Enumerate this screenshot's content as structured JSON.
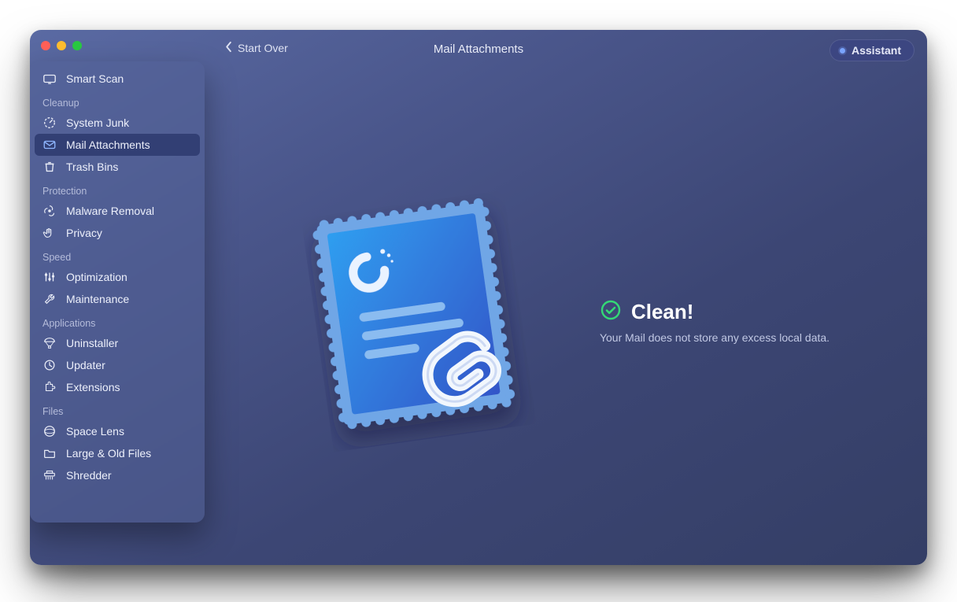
{
  "header": {
    "back_label": "Start Over",
    "title": "Mail Attachments",
    "assistant_label": "Assistant"
  },
  "sidebar": {
    "top_item": {
      "label": "Smart Scan",
      "icon": "scan-icon"
    },
    "sections": [
      {
        "title": "Cleanup",
        "items": [
          {
            "label": "System Junk",
            "icon": "gauge-icon",
            "selected": false
          },
          {
            "label": "Mail Attachments",
            "icon": "mail-icon",
            "selected": true
          },
          {
            "label": "Trash Bins",
            "icon": "trash-icon",
            "selected": false
          }
        ]
      },
      {
        "title": "Protection",
        "items": [
          {
            "label": "Malware Removal",
            "icon": "hazard-icon",
            "selected": false
          },
          {
            "label": "Privacy",
            "icon": "hand-icon",
            "selected": false
          }
        ]
      },
      {
        "title": "Speed",
        "items": [
          {
            "label": "Optimization",
            "icon": "sliders-icon",
            "selected": false
          },
          {
            "label": "Maintenance",
            "icon": "wrench-icon",
            "selected": false
          }
        ]
      },
      {
        "title": "Applications",
        "items": [
          {
            "label": "Uninstaller",
            "icon": "parachute-icon",
            "selected": false
          },
          {
            "label": "Updater",
            "icon": "updater-icon",
            "selected": false
          },
          {
            "label": "Extensions",
            "icon": "puzzle-icon",
            "selected": false
          }
        ]
      },
      {
        "title": "Files",
        "items": [
          {
            "label": "Space Lens",
            "icon": "lens-icon",
            "selected": false
          },
          {
            "label": "Large & Old Files",
            "icon": "folder-icon",
            "selected": false
          },
          {
            "label": "Shredder",
            "icon": "shredder-icon",
            "selected": false
          }
        ]
      }
    ]
  },
  "result": {
    "title": "Clean!",
    "subtitle": "Your Mail does not store any excess local data."
  },
  "colors": {
    "accent_green": "#34d976",
    "stamp_gradient_start": "#2f9ef0",
    "stamp_gradient_end": "#3255c8"
  }
}
